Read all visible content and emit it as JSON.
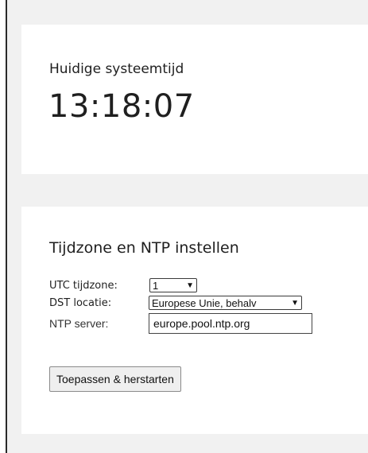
{
  "time_card": {
    "label": "Huidige systeemtijd",
    "value": "13:18:07"
  },
  "tz_card": {
    "title": "Tijdzone en NTP instellen",
    "utc": {
      "label": "UTC tijdzone:",
      "selected": "1"
    },
    "dst": {
      "label": "DST locatie:",
      "selected": "Europese Unie, behalv"
    },
    "ntp": {
      "label": "NTP server:",
      "value": "europe.pool.ntp.org"
    },
    "apply_label": "Toepassen & herstarten"
  }
}
